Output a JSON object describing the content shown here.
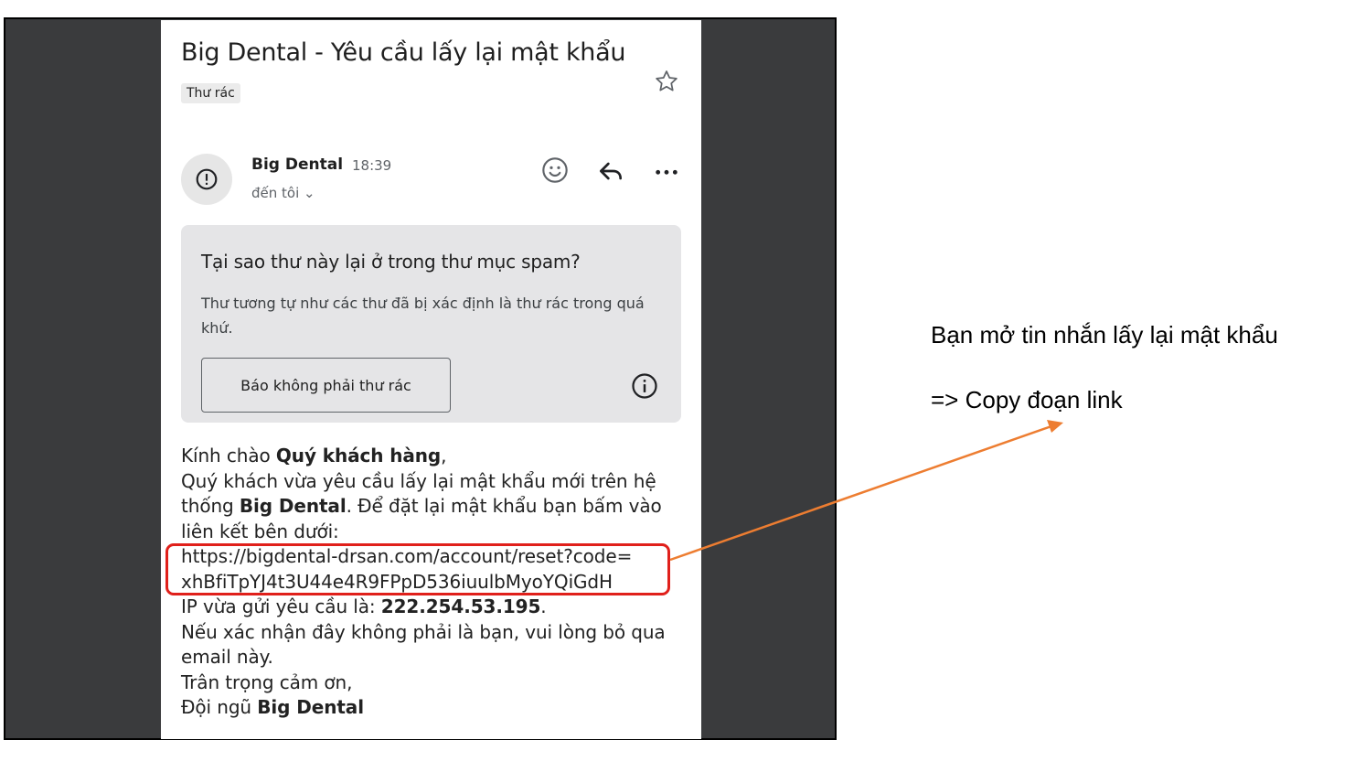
{
  "email": {
    "subject": "Big Dental - Yêu cầu lấy lại mật khẩu",
    "label": "Thư rác",
    "sender_name": "Big Dental",
    "time": "18:39",
    "recipient": "đến tôi ⌄",
    "icons": [
      "star-icon",
      "alert-icon",
      "emoji-icon",
      "reply-icon",
      "more-icon",
      "info-icon"
    ]
  },
  "spam_notice": {
    "title": "Tại sao thư này lại ở trong thư mục spam?",
    "description": "Thư tương tự như các thư đã bị xác định là thư rác trong quá khứ.",
    "button_label": "Báo không phải thư rác"
  },
  "message": {
    "greeting": "Kính chào ",
    "greeting_name": "Quý khách hàng",
    "greeting_end": ",",
    "line1": "Quý khách vừa yêu cầu lấy lại mật khẩu mới trên hệ thống ",
    "brand": "Big Dental",
    "line1_end": ". Để đặt lại mật khẩu bạn bấm vào liên kết bên dưới:",
    "link_line1": "https://bigdental-drsan.com/account/reset?code=",
    "link_line2": "xhBfiTpYJ4t3U44e4R9FPpD536iuulbMyoYQiGdH",
    "ip_label": "IP vừa gửi yêu cầu là: ",
    "ip": "222.254.53.195",
    "ip_end": ".",
    "ignore": "Nếu xác nhận đây không phải là bạn, vui lòng bỏ qua email này.",
    "thanks": "Trân trọng cảm ơn,",
    "team_prefix": "Đội ngũ ",
    "team": "Big Dental"
  },
  "annotation": {
    "line1": "Bạn mở tin nhắn lấy lại mật khẩu",
    "line2": "=> Copy đoạn link",
    "highlight_color": "#e0201b",
    "arrow_color": "#ed7d31"
  }
}
